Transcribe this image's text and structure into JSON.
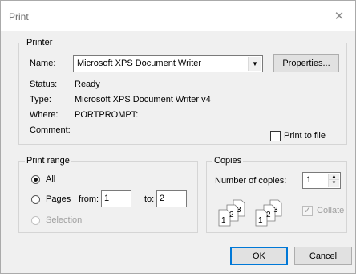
{
  "window": {
    "title": "Print",
    "close_glyph": "✕"
  },
  "printer": {
    "group_label": "Printer",
    "name_label": "Name:",
    "name_value": "Microsoft XPS Document Writer",
    "properties_label": "Properties...",
    "status_label": "Status:",
    "status_value": "Ready",
    "type_label": "Type:",
    "type_value": "Microsoft XPS Document Writer v4",
    "where_label": "Where:",
    "where_value": "PORTPROMPT:",
    "comment_label": "Comment:",
    "print_to_file_label": "Print to file",
    "print_to_file_checked": false
  },
  "print_range": {
    "group_label": "Print range",
    "all_label": "All",
    "pages_label": "Pages",
    "from_label": "from:",
    "from_value": "1",
    "to_label": "to:",
    "to_value": "2",
    "selection_label": "Selection",
    "selected": "All"
  },
  "copies": {
    "group_label": "Copies",
    "number_label": "Number of copies:",
    "number_value": "1",
    "collate_label": "Collate",
    "collate_checked": true,
    "collate_enabled": false,
    "collate_digits": [
      "1",
      "2",
      "3"
    ]
  },
  "actions": {
    "ok_label": "OK",
    "cancel_label": "Cancel"
  }
}
